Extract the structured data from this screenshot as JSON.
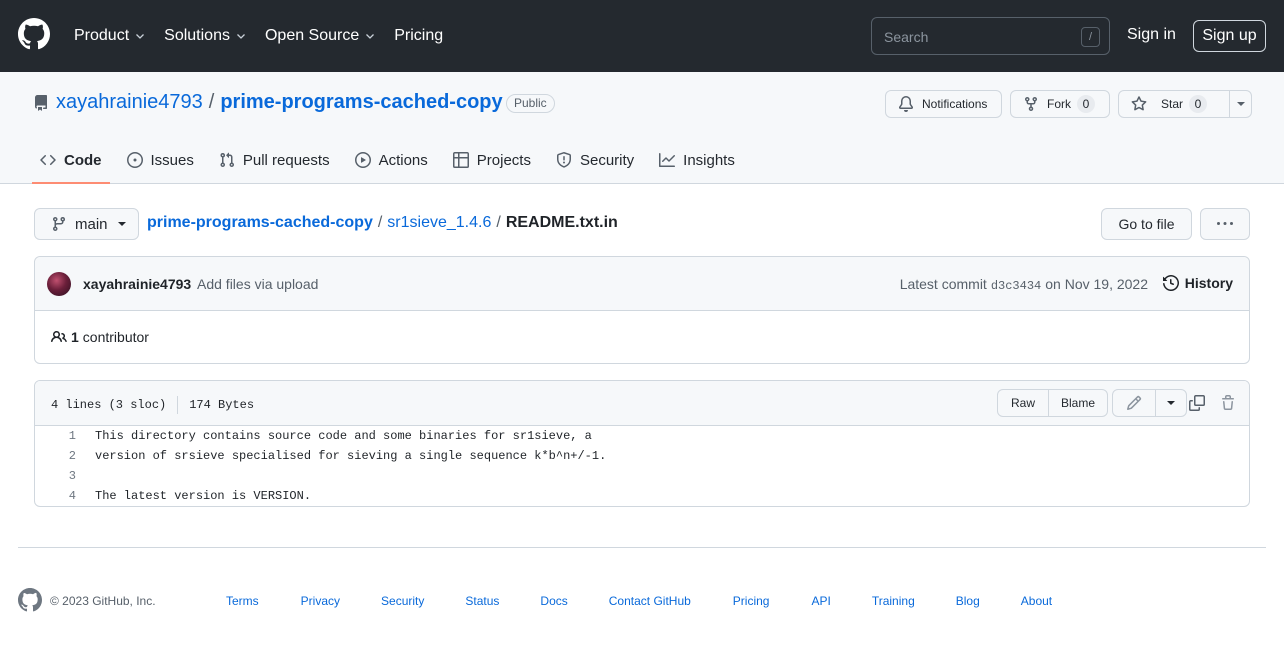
{
  "header": {
    "nav": [
      {
        "label": "Product",
        "has_menu": true
      },
      {
        "label": "Solutions",
        "has_menu": true
      },
      {
        "label": "Open Source",
        "has_menu": true
      },
      {
        "label": "Pricing",
        "has_menu": false
      }
    ],
    "search_placeholder": "Search",
    "search_shortcut": "/",
    "sign_in": "Sign in",
    "sign_up": "Sign up"
  },
  "repo": {
    "owner": "xayahrainie4793",
    "separator": "/",
    "name": "prime-programs-cached-copy",
    "visibility": "Public",
    "actions": {
      "notifications": "Notifications",
      "fork_label": "Fork",
      "fork_count": "0",
      "star_label": "Star",
      "star_count": "0"
    },
    "tabs": [
      {
        "label": "Code",
        "icon": "code-icon",
        "active": true
      },
      {
        "label": "Issues",
        "icon": "issue-icon",
        "active": false
      },
      {
        "label": "Pull requests",
        "icon": "pull-request-icon",
        "active": false
      },
      {
        "label": "Actions",
        "icon": "play-icon",
        "active": false
      },
      {
        "label": "Projects",
        "icon": "table-icon",
        "active": false
      },
      {
        "label": "Security",
        "icon": "shield-icon",
        "active": false
      },
      {
        "label": "Insights",
        "icon": "graph-icon",
        "active": false
      }
    ]
  },
  "breadcrumb": {
    "branch": "main",
    "repo": "prime-programs-cached-copy",
    "dir": "sr1sieve_1.4.6",
    "file": "README.txt.in",
    "sep": "/",
    "go_to_file": "Go to file"
  },
  "commit": {
    "author": "xayahrainie4793",
    "message": "Add files via upload",
    "latest_prefix": "Latest commit",
    "sha": "d3c3434",
    "date": "on Nov 19, 2022",
    "history": "History",
    "contributors_count": "1",
    "contributors_label": "contributor"
  },
  "file": {
    "lines_info": "4 lines (3 sloc)",
    "size": "174 Bytes",
    "raw": "Raw",
    "blame": "Blame",
    "lines": [
      {
        "n": "1",
        "text": "This directory contains source code and some binaries for sr1sieve, a"
      },
      {
        "n": "2",
        "text": "version of srsieve specialised for sieving a single sequence k*b^n+/-1."
      },
      {
        "n": "3",
        "text": ""
      },
      {
        "n": "4",
        "text": "The latest version is VERSION."
      }
    ]
  },
  "footer": {
    "copyright": "© 2023 GitHub, Inc.",
    "links": [
      "Terms",
      "Privacy",
      "Security",
      "Status",
      "Docs",
      "Contact GitHub",
      "Pricing",
      "API",
      "Training",
      "Blog",
      "About"
    ]
  },
  "colors": {
    "header_bg": "#24292f",
    "link": "#0969da",
    "active_tab_underline": "#fd8c73",
    "border": "#d0d7de"
  }
}
